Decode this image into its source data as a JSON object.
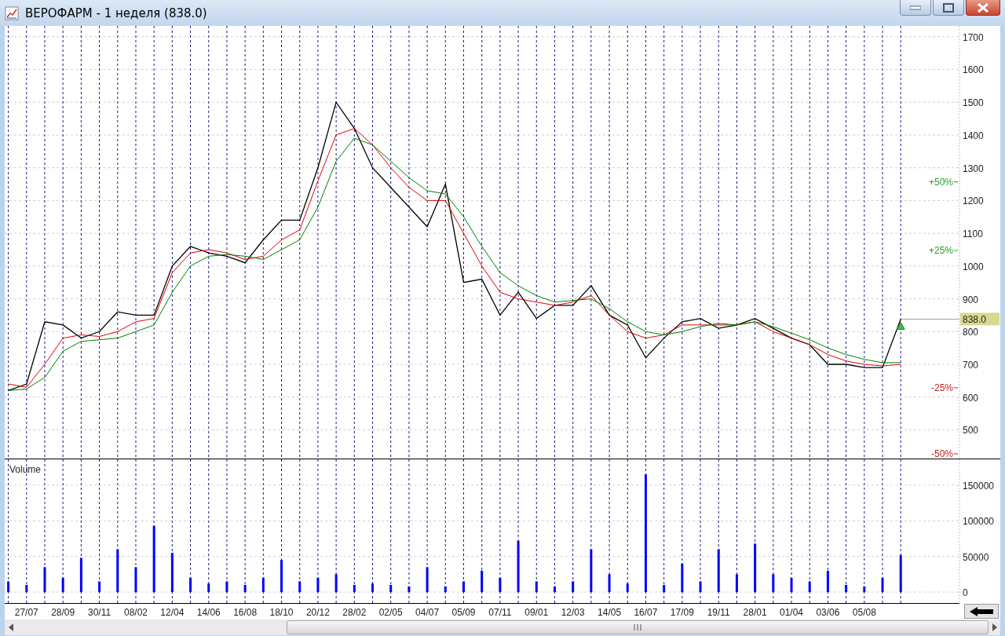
{
  "window": {
    "title": "ВЕРОФАРМ - 1 неделя (838.0)"
  },
  "price": {
    "last_price": {
      "label": "838.0"
    },
    "chart_data": {
      "type": "line",
      "series": [
        {
          "color": "#000000",
          "values": [
            620,
            640,
            830,
            820,
            780,
            800,
            860,
            850,
            850,
            1000,
            1060,
            1040,
            1030,
            1010,
            1080,
            1140,
            1140,
            1300,
            1500,
            1420,
            1300,
            1240,
            1180,
            1120,
            1250,
            950,
            960,
            850,
            920,
            840,
            880,
            880,
            940,
            850,
            820,
            720,
            780,
            830,
            840,
            810,
            820,
            840,
            810,
            780,
            760,
            700,
            700,
            690,
            690,
            838
          ]
        },
        {
          "color": "#e00000",
          "values": [
            640,
            630,
            700,
            780,
            790,
            785,
            800,
            830,
            840,
            980,
            1040,
            1050,
            1040,
            1020,
            1030,
            1080,
            1110,
            1260,
            1400,
            1420,
            1370,
            1300,
            1240,
            1200,
            1200,
            1100,
            1000,
            920,
            900,
            890,
            880,
            890,
            910,
            850,
            800,
            780,
            790,
            820,
            820,
            820,
            820,
            830,
            800,
            780,
            760,
            730,
            710,
            700,
            695,
            700
          ]
        },
        {
          "color": "#008000",
          "values": [
            620,
            625,
            660,
            740,
            770,
            775,
            780,
            800,
            820,
            920,
            1000,
            1030,
            1035,
            1030,
            1020,
            1050,
            1080,
            1180,
            1320,
            1390,
            1370,
            1320,
            1270,
            1230,
            1220,
            1150,
            1060,
            980,
            940,
            910,
            890,
            895,
            900,
            870,
            830,
            800,
            790,
            800,
            815,
            825,
            820,
            830,
            815,
            795,
            775,
            750,
            730,
            715,
            705,
            705
          ]
        }
      ],
      "ylim": [
        410,
        1733
      ],
      "yticks": [
        500,
        600,
        700,
        800,
        900,
        1000,
        1100,
        1200,
        1300,
        1400,
        1500,
        1600,
        1700
      ],
      "grid": true
    }
  },
  "percent_marks": [
    {
      "label": "+50%"
    },
    {
      "label": "+25%"
    },
    {
      "label": "-25%"
    },
    {
      "label": "-50%"
    }
  ],
  "volume": {
    "title": "Volume",
    "chart_data": {
      "type": "bar",
      "categories": [
        null,
        "27/07",
        null,
        "28/09",
        null,
        "30/11",
        null,
        "08/02",
        null,
        "12/04",
        null,
        "14/06",
        null,
        "16/08",
        null,
        "18/10",
        null,
        "20/12",
        null,
        "28/02",
        null,
        "02/05",
        null,
        "04/07",
        null,
        "05/09",
        null,
        "07/11",
        null,
        "09/01",
        null,
        "12/03",
        null,
        "14/05",
        null,
        "16/07",
        null,
        "17/09",
        null,
        "19/11",
        null,
        "28/01",
        null,
        "01/04",
        null,
        "03/06",
        null,
        "05/08",
        null,
        null
      ],
      "values": [
        15000,
        10000,
        35000,
        20000,
        48000,
        15000,
        60000,
        35000,
        93000,
        55000,
        20000,
        12000,
        15000,
        10000,
        20000,
        45000,
        15000,
        20000,
        25000,
        10000,
        12000,
        10000,
        8000,
        35000,
        8000,
        15000,
        30000,
        20000,
        72000,
        15000,
        8000,
        15000,
        60000,
        25000,
        12000,
        165000,
        10000,
        40000,
        15000,
        60000,
        25000,
        68000,
        25000,
        20000,
        15000,
        30000,
        10000,
        8000,
        20000,
        52000
      ],
      "color": "#0000ff",
      "grid": true,
      "ylim": [
        -15400,
        186300
      ],
      "yticks": [
        0,
        50000,
        100000,
        150000
      ]
    }
  }
}
